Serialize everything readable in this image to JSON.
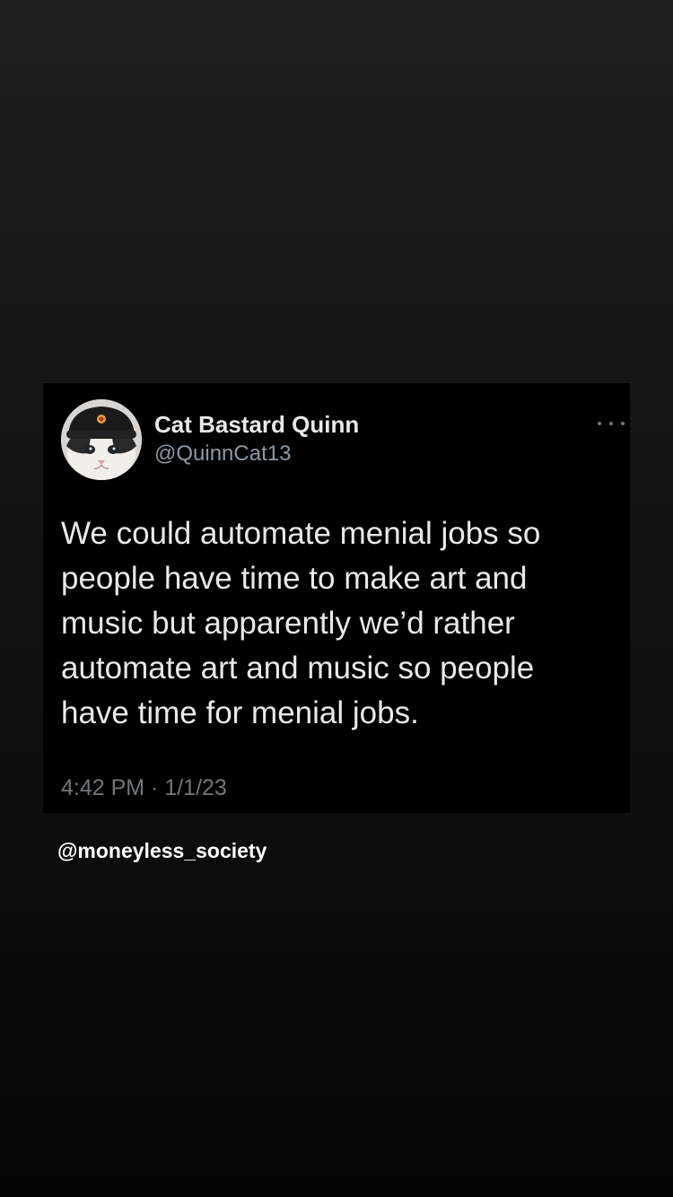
{
  "tweet": {
    "author_name": "Cat Bastard Quinn",
    "author_handle": "@QuinnCat13",
    "avatar_icon": "cat-with-ushanka-avatar",
    "more_icon": "ellipsis-icon",
    "text": "We could automate menial jobs so people have time to make art and music but apparently we’d rather automate art and music so people have time for menial jobs.",
    "timestamp": "4:42 PM · 1/1/23"
  },
  "attribution": {
    "text": "@moneyless_society"
  },
  "colors": {
    "background": "#161616",
    "card": "#000000",
    "primary_text": "#e7e9ea",
    "secondary_text": "#71767b"
  }
}
